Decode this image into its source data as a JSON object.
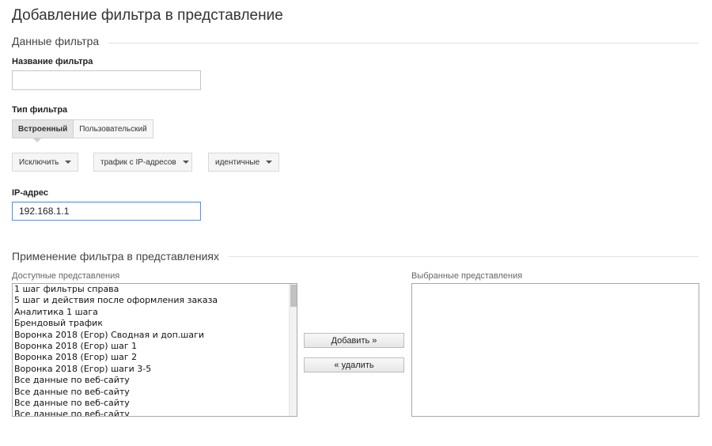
{
  "page_title": "Добавление фильтра в представление",
  "filter_data": {
    "section_title": "Данные фильтра",
    "name_label": "Название фильтра",
    "name_value": "",
    "type_label": "Тип фильтра",
    "type_tabs": [
      "Встроенный",
      "Пользовательский"
    ],
    "type_tab_selected": "Встроенный",
    "dropdowns": {
      "action": "Исключить",
      "source": "трафик с IP-адресов",
      "match": "идентичные"
    },
    "ip_label": "IP-адрес",
    "ip_value": "192.168.1.1"
  },
  "apply": {
    "section_title": "Применение фильтра в представлениях",
    "available_label": "Доступные представления",
    "selected_label": "Выбранные представления",
    "available_items": [
      "1 шаг фильтры справа",
      "5 шаг и действия после оформления заказа",
      "Аналитика 1 шага",
      "Брендовый трафик",
      "Воронка 2018 (Егор) Сводная и доп.шаги",
      "Воронка 2018 (Егор) шаг 1",
      "Воронка 2018 (Егор) шаг 2",
      "Воронка 2018 (Егор) шаги 3-5",
      "Все данные по веб-сайту",
      "Все данные по веб-сайту",
      "Все данные по веб-сайту",
      "Все данные по веб-сайту"
    ],
    "selected_items": [],
    "add_button": "Добавить »",
    "remove_button": "« удалить"
  }
}
